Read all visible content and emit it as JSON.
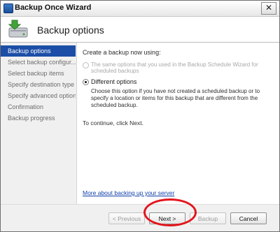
{
  "window": {
    "title": "Backup Once Wizard",
    "close_glyph": "✕"
  },
  "header": {
    "title": "Backup options"
  },
  "steps": [
    {
      "label": "Backup options",
      "active": true
    },
    {
      "label": "Select backup configur...",
      "active": false
    },
    {
      "label": "Select backup items",
      "active": false
    },
    {
      "label": "Specify destination type",
      "active": false
    },
    {
      "label": "Specify advanced option",
      "active": false
    },
    {
      "label": "Confirmation",
      "active": false
    },
    {
      "label": "Backup progress",
      "active": false
    }
  ],
  "content": {
    "prompt": "Create a backup now using:",
    "option_same": {
      "label": "The same options that you used in the Backup Schedule Wizard for scheduled backups",
      "enabled": false,
      "selected": false
    },
    "option_different": {
      "label": "Different options",
      "enabled": true,
      "selected": true,
      "description": "Choose this option if you have not created a scheduled backup or to specify a location or items for this backup that are different from the scheduled backup."
    },
    "continue_text": "To continue, click Next.",
    "help_link": "More about backing up your server"
  },
  "footer": {
    "previous": "< Previous",
    "next": "Next >",
    "backup": "Backup",
    "cancel": "Cancel"
  },
  "colors": {
    "active_step": "#1c4ea7",
    "highlight_ellipse": "#e3151c",
    "link": "#0d3ea8"
  }
}
